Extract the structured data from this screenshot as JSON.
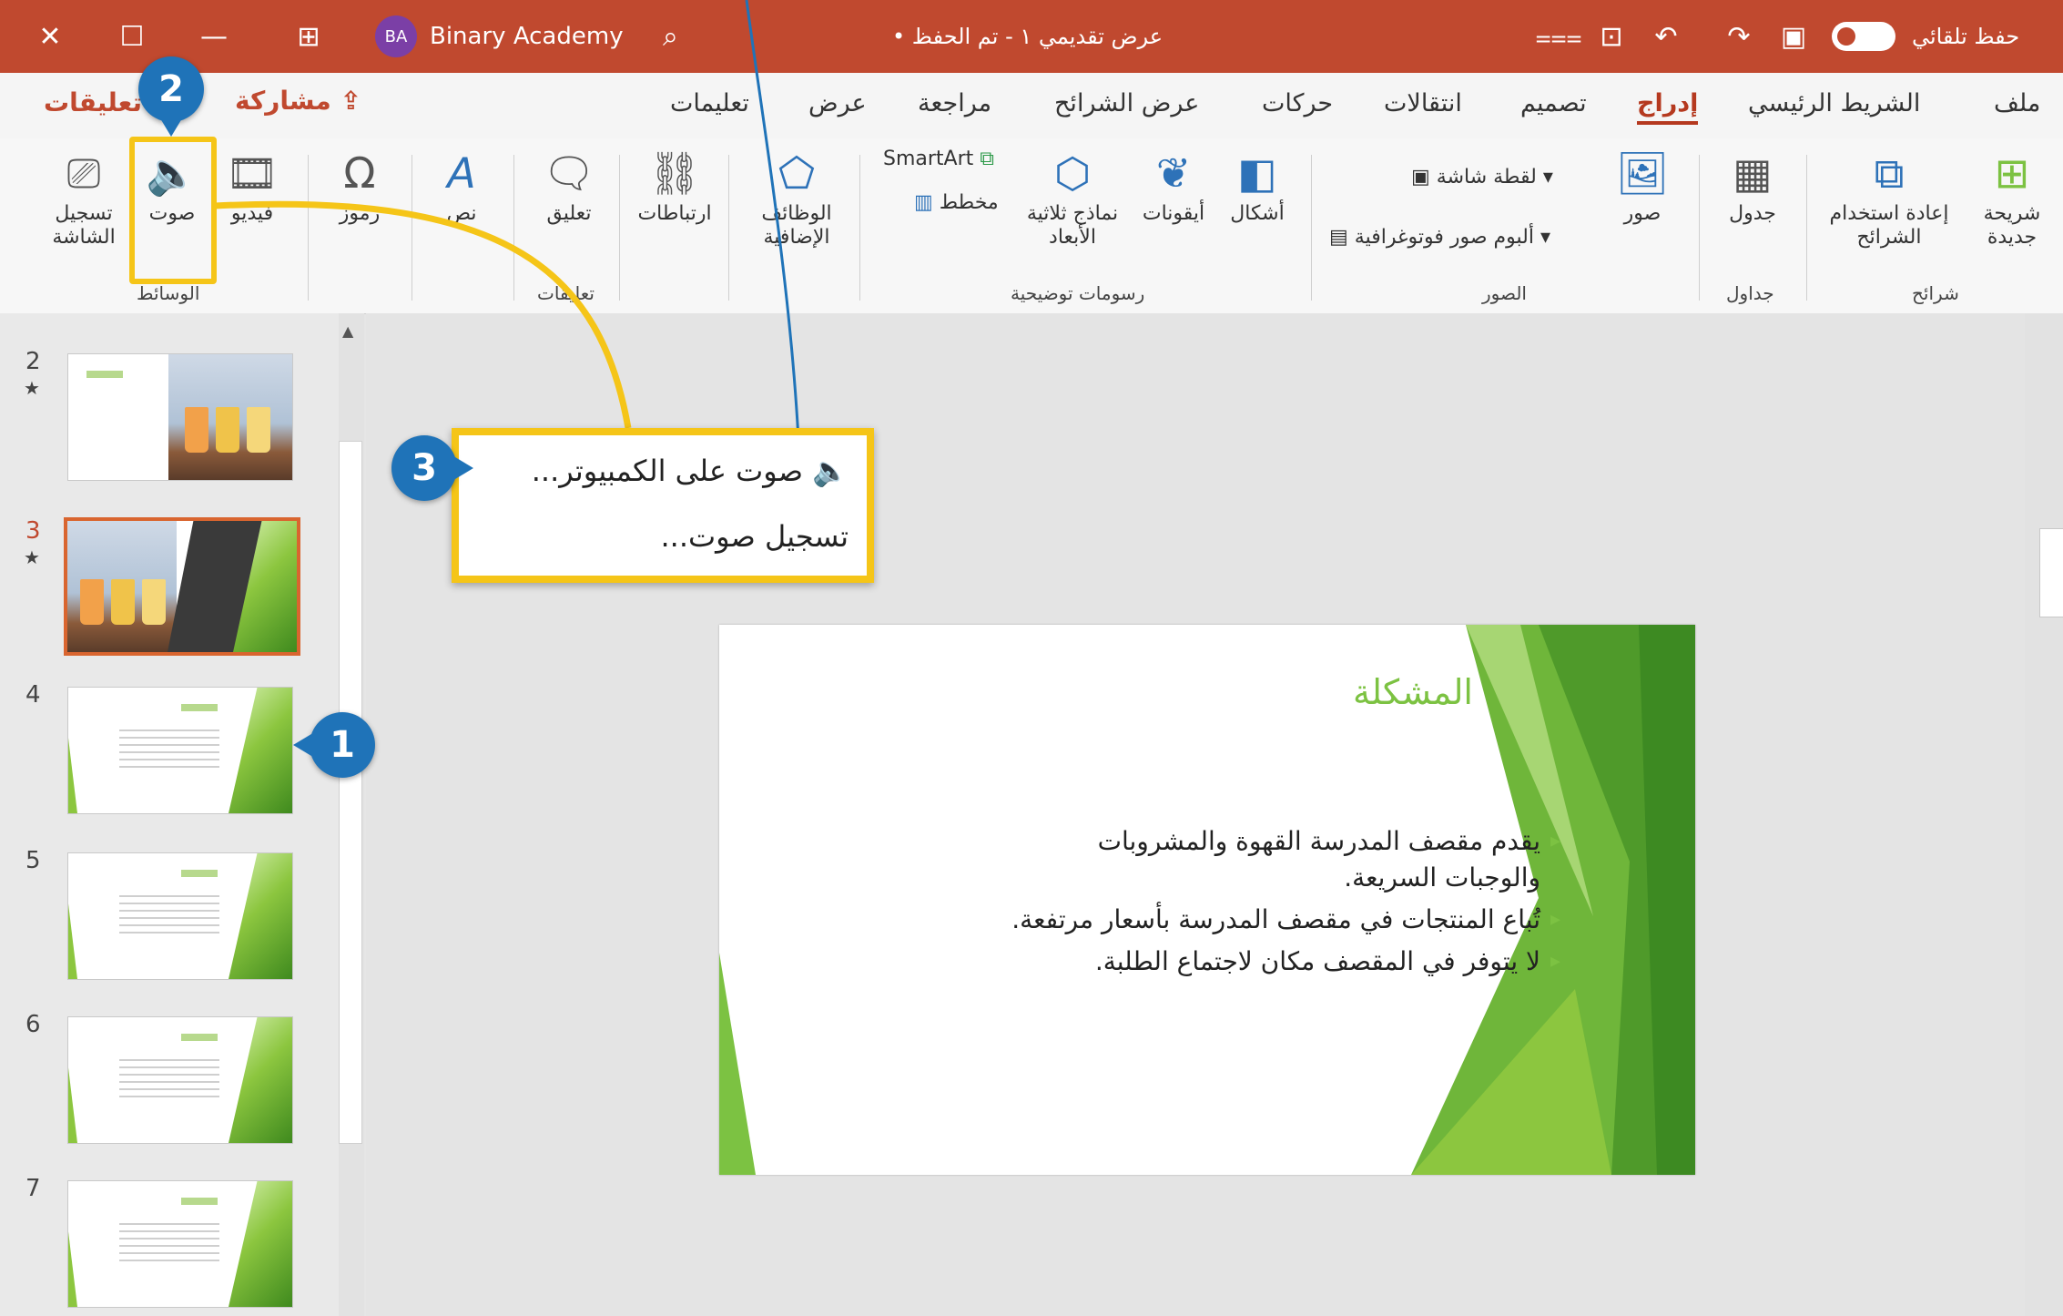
{
  "titlebar": {
    "account_initials": "BA",
    "account_name": "Binary Academy",
    "doc_title": "عرض تقديمي ١ - تم الحفظ •",
    "autosave_label": "حفظ تلقائي",
    "close_glyph": "✕",
    "restore_glyph": "☐",
    "minimize_glyph": "—",
    "layout_glyph": "⊞",
    "search_glyph": "⌕",
    "present_glyph": "⊡",
    "undo_glyph": "↶",
    "redo_glyph": "↷",
    "save_glyph": "▣",
    "more_glyph": "⩶"
  },
  "tabs": {
    "file": "ملف",
    "home": "الشريط الرئيسي",
    "insert": "إدراج",
    "design": "تصميم",
    "transitions": "انتقالات",
    "animations": "حركات",
    "slideshow": "عرض الشرائح",
    "review": "مراجعة",
    "view": "عرض",
    "help": "تعليمات",
    "share": "مشاركة",
    "comments": "تعليقات",
    "active": "insert"
  },
  "ribbon": {
    "slides": {
      "new_slide": "شريحة جديدة",
      "reuse_slides": "إعادة استخدام الشرائح",
      "group": "شرائح"
    },
    "tables": {
      "table": "جدول",
      "group": "جداول"
    },
    "images": {
      "pictures": "صور",
      "screenshot": "لقطة شاشة",
      "photo_album": "ألبوم صور فوتوغرافية",
      "group": "الصور"
    },
    "illustrations": {
      "shapes": "أشكال",
      "icons": "أيقونات",
      "models_3d": "نماذج ثلاثية الأبعاد",
      "smartart": "SmartArt",
      "chart": "مخطط",
      "group": "رسومات توضيحية"
    },
    "addins": {
      "addins": "الوظائف الإضافية"
    },
    "links": {
      "links": "ارتباطات"
    },
    "comments": {
      "comment": "تعليق",
      "group": "تعليقات"
    },
    "text": {
      "text": "نص"
    },
    "symbols": {
      "symbols": "رموز"
    },
    "media": {
      "video": "فيديو",
      "audio": "صوت",
      "screen_recording": "تسجيل الشاشة",
      "group": "الوسائط"
    }
  },
  "thumbnails": [
    {
      "number": "2",
      "star": "★"
    },
    {
      "number": "3",
      "star": "★"
    },
    {
      "number": "4"
    },
    {
      "number": "5"
    },
    {
      "number": "6"
    },
    {
      "number": "7"
    }
  ],
  "audio_menu": {
    "audio_on_pc": "صوت على الكمبيوتر...",
    "record_audio": "تسجيل صوت..."
  },
  "slide": {
    "title": "المشكلة",
    "bullets": [
      "يقدم مقصف المدرسة القهوة والمشروبات والوجبات السريعة.",
      "تُباع المنتجات في مقصف المدرسة بأسعار مرتفعة.",
      "لا يتوفر في المقصف مكان لاجتماع الطلبة."
    ]
  },
  "callouts": {
    "step1": "1",
    "step2": "2",
    "step3": "3"
  },
  "colors": {
    "titlebar": "#c0492f",
    "accent_green": "#7cc242",
    "highlight": "#f5c518",
    "badge": "#1f73b8"
  }
}
